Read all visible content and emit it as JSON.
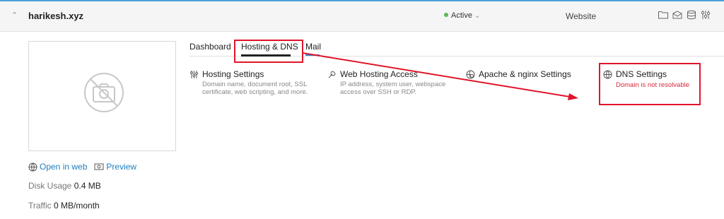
{
  "header": {
    "domain": "harikesh.xyz",
    "status": "Active",
    "hosting_type": "Website"
  },
  "links": {
    "open_in_web": "Open in web",
    "preview": "Preview"
  },
  "stats": {
    "disk_usage_label": "Disk Usage",
    "disk_usage_value": "0.4 MB",
    "traffic_label": "Traffic",
    "traffic_value": "0 MB/month"
  },
  "tabs": {
    "dashboard": "Dashboard",
    "hosting_dns": "Hosting & DNS",
    "mail": "Mail"
  },
  "features": {
    "hosting_settings": {
      "title": "Hosting Settings",
      "desc": "Domain name, document root, SSL certificate, web scripting, and more."
    },
    "web_hosting_access": {
      "title": "Web Hosting Access",
      "desc": "IP address, system user, webspace access over SSH or RDP."
    },
    "apache_nginx": {
      "title": "Apache & nginx Settings"
    },
    "dns_settings": {
      "title": "DNS Settings",
      "error": "Domain is not resolvable"
    }
  },
  "colors": {
    "accent": "#1e7fc0",
    "annotation_red": "#e0142b",
    "status_green": "#5cb85c",
    "error_text": "#d9283a"
  },
  "icons": [
    "chevron-up-icon",
    "folder-icon",
    "mail-icon",
    "database-icon",
    "sliders-icon",
    "no-camera-icon",
    "globe-icon",
    "eye-icon",
    "wrench-icon",
    "gear-globe-icon"
  ]
}
